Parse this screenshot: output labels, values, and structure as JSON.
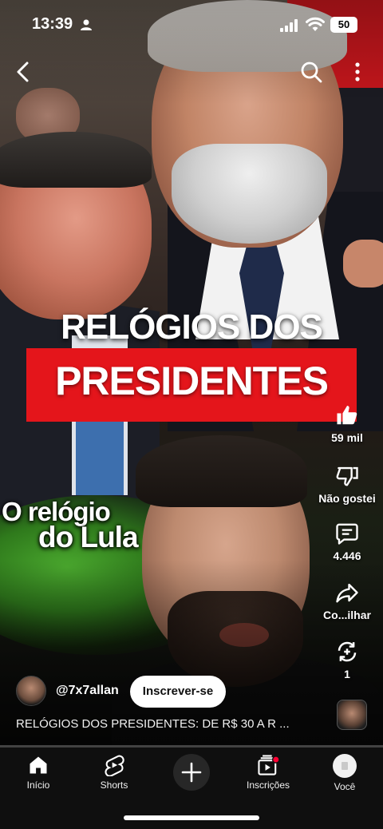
{
  "status_bar": {
    "time": "13:39",
    "battery": "50"
  },
  "video": {
    "headline_line1": "RELÓGIOS DOS",
    "headline_line2": "PRESIDENTES",
    "caption_line1": "O relógio",
    "caption_line2": "do Lula",
    "progress": 0.0
  },
  "actions": {
    "like_count": "59 mil",
    "dislike_label": "Não gostei",
    "comment_count": "4.446",
    "share_label": "Co...ilhar",
    "remix_count": "1"
  },
  "channel": {
    "handle": "@7x7allan",
    "subscribe_label": "Inscrever-se"
  },
  "title": "RELÓGIOS DOS PRESIDENTES: DE R$ 30 A R ...",
  "bottom_nav": {
    "home": "Início",
    "shorts": "Shorts",
    "subscriptions": "Inscrições",
    "you": "Você"
  },
  "colors": {
    "accent": "#ff0033",
    "headline_red": "#e4151b",
    "nav_bg": "#0f0f0f"
  },
  "icons": [
    "back-icon",
    "search-icon",
    "more-vert-icon",
    "like-icon",
    "dislike-icon",
    "comment-icon",
    "share-icon",
    "remix-icon",
    "home-icon",
    "shorts-icon",
    "plus-icon",
    "subscriptions-icon"
  ]
}
